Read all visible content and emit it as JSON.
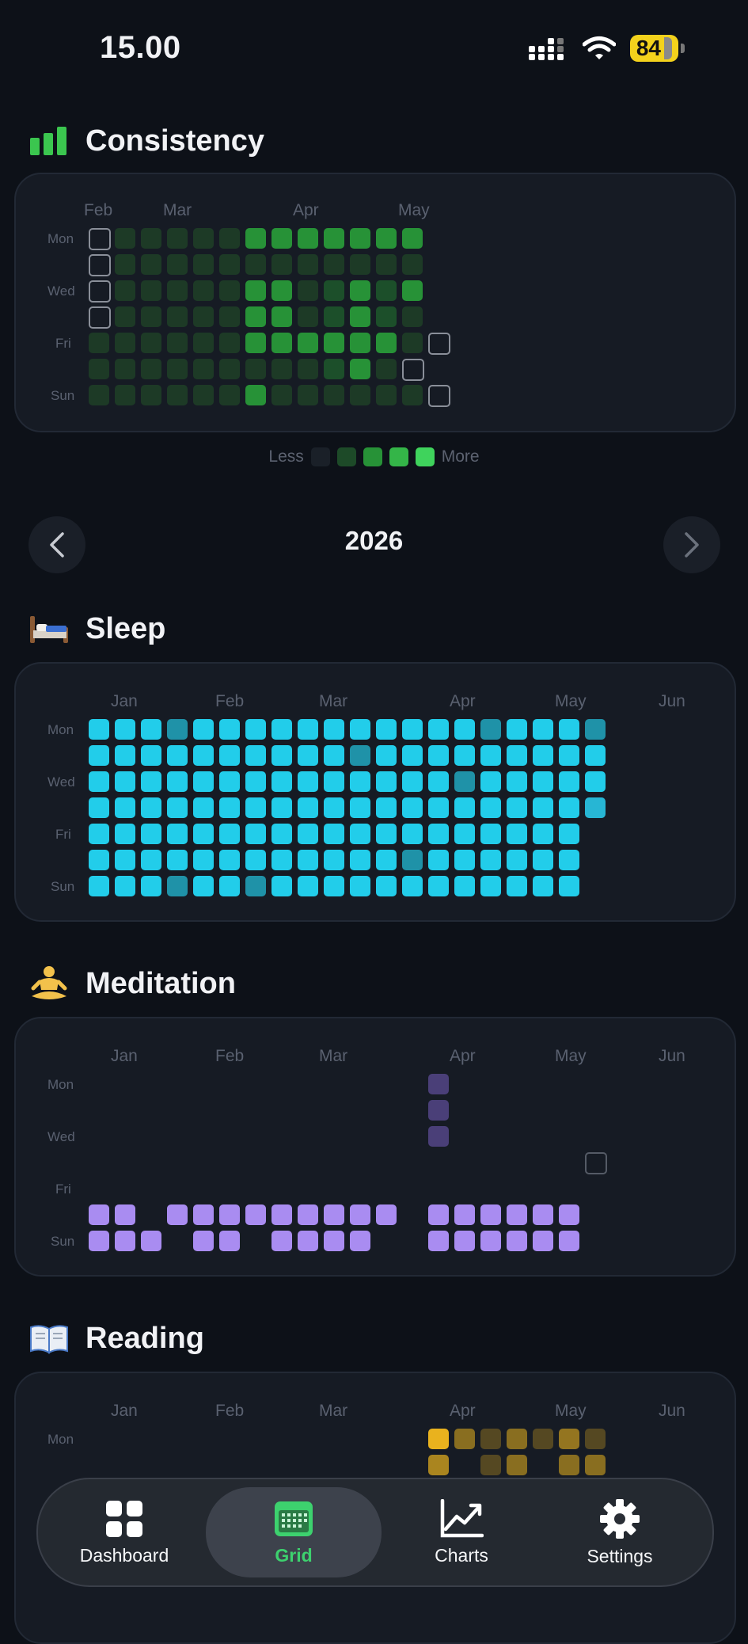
{
  "status": {
    "time": "15.00",
    "battery": "84"
  },
  "consistency": {
    "title": "Consistency",
    "months": [
      "Feb",
      "Mar",
      "Apr",
      "May"
    ],
    "days": [
      "Mon",
      "Wed",
      "Fri",
      "Sun"
    ]
  },
  "legend": {
    "less": "Less",
    "more": "More"
  },
  "year": "2026",
  "sleep": {
    "title": "Sleep",
    "months": [
      "Jan",
      "Feb",
      "Mar",
      "Apr",
      "May",
      "Jun"
    ],
    "days": [
      "Mon",
      "Wed",
      "Fri",
      "Sun"
    ]
  },
  "meditation": {
    "title": "Meditation",
    "months": [
      "Jan",
      "Feb",
      "Mar",
      "Apr",
      "May",
      "Jun"
    ],
    "days": [
      "Mon",
      "Wed",
      "Fri",
      "Sun"
    ]
  },
  "reading": {
    "title": "Reading",
    "months": [
      "Jan",
      "Feb",
      "Mar",
      "Apr",
      "May",
      "Jun"
    ],
    "days": [
      "Mon"
    ]
  },
  "tabs": [
    {
      "label": "Dashboard",
      "icon": "dashboard-grid-icon"
    },
    {
      "label": "Grid",
      "icon": "calendar-grid-icon"
    },
    {
      "label": "Charts",
      "icon": "line-chart-icon"
    },
    {
      "label": "Settings",
      "icon": "gear-icon"
    }
  ],
  "colors": {
    "green_levels": [
      "#1d3a26",
      "#1c4f2a",
      "#279237",
      "#3bc64f",
      "#3fd35c"
    ],
    "sleep": "#22cdea",
    "sleep_dim": "#1f92a8",
    "meditation": "#a98cf1",
    "meditation_dim": "#4a3f78",
    "reading": "#e9b21e"
  }
}
